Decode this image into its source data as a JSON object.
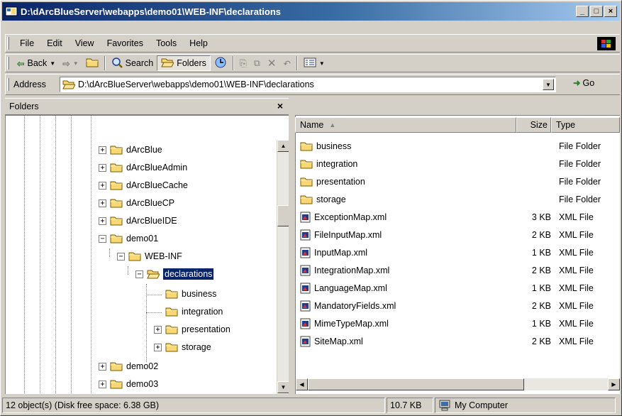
{
  "window": {
    "title": "D:\\dArcBlueServer\\webapps\\demo01\\WEB-INF\\declarations"
  },
  "menu": [
    "File",
    "Edit",
    "View",
    "Favorites",
    "Tools",
    "Help"
  ],
  "toolbar": {
    "back": "Back",
    "search": "Search",
    "folders": "Folders"
  },
  "address": {
    "label": "Address",
    "value": "D:\\dArcBlueServer\\webapps\\demo01\\WEB-INF\\declarations",
    "go": "Go"
  },
  "folders_pane": {
    "title": "Folders",
    "close": "×",
    "items": [
      {
        "label": "dArcBlue"
      },
      {
        "label": "dArcBlueAdmin"
      },
      {
        "label": "dArcBlueCache"
      },
      {
        "label": "dArcBlueCP"
      },
      {
        "label": "dArcBlueIDE"
      },
      {
        "label": "demo01"
      },
      {
        "label": "WEB-INF"
      },
      {
        "label": "declarations"
      },
      {
        "label": "business"
      },
      {
        "label": "integration"
      },
      {
        "label": "presentation"
      },
      {
        "label": "storage"
      },
      {
        "label": "demo02"
      },
      {
        "label": "demo03"
      }
    ]
  },
  "list": {
    "columns": {
      "name": "Name",
      "size": "Size",
      "type": "Type"
    },
    "rows": [
      {
        "name": "business",
        "size": "",
        "type": "File Folder",
        "icon": "folder-icon"
      },
      {
        "name": "integration",
        "size": "",
        "type": "File Folder",
        "icon": "folder-icon"
      },
      {
        "name": "presentation",
        "size": "",
        "type": "File Folder",
        "icon": "folder-icon"
      },
      {
        "name": "storage",
        "size": "",
        "type": "File Folder",
        "icon": "folder-icon"
      },
      {
        "name": "ExceptionMap.xml",
        "size": "3 KB",
        "type": "XML File",
        "icon": "xml-file-icon"
      },
      {
        "name": "FileInputMap.xml",
        "size": "2 KB",
        "type": "XML File",
        "icon": "xml-file-icon"
      },
      {
        "name": "InputMap.xml",
        "size": "1 KB",
        "type": "XML File",
        "icon": "xml-file-icon"
      },
      {
        "name": "IntegrationMap.xml",
        "size": "2 KB",
        "type": "XML File",
        "icon": "xml-file-icon"
      },
      {
        "name": "LanguageMap.xml",
        "size": "1 KB",
        "type": "XML File",
        "icon": "xml-file-icon"
      },
      {
        "name": "MandatoryFields.xml",
        "size": "2 KB",
        "type": "XML File",
        "icon": "xml-file-icon"
      },
      {
        "name": "MimeTypeMap.xml",
        "size": "1 KB",
        "type": "XML File",
        "icon": "xml-file-icon"
      },
      {
        "name": "SiteMap.xml",
        "size": "2 KB",
        "type": "XML File",
        "icon": "xml-file-icon"
      }
    ]
  },
  "status": {
    "objects": "12 object(s) (Disk free space: 6.38 GB)",
    "size": "10.7 KB",
    "zone": "My Computer"
  },
  "colors": {
    "title_start": "#0a246a",
    "title_end": "#a6caf0",
    "selection": "#0a246a",
    "folder": "#f8d775"
  }
}
